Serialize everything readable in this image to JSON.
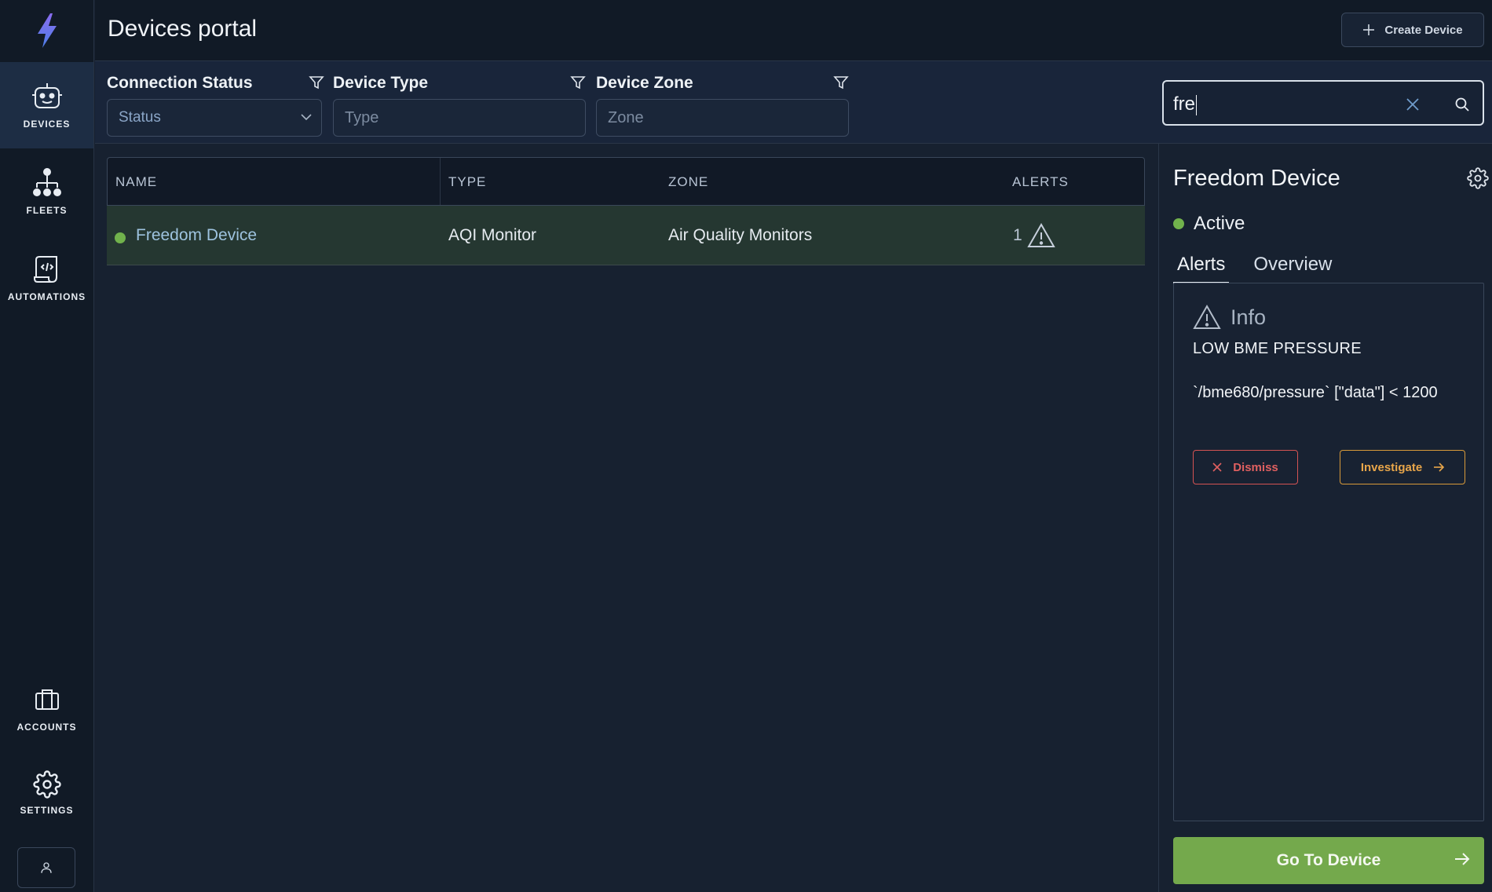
{
  "app": {
    "title": "Devices portal"
  },
  "sidebar": {
    "items": [
      {
        "label": "DEVICES",
        "icon": "robot-icon",
        "active": true
      },
      {
        "label": "FLEETS",
        "icon": "hierarchy-icon"
      },
      {
        "label": "AUTOMATIONS",
        "icon": "script-icon"
      },
      {
        "label": "ACCOUNTS",
        "icon": "briefcase-icon"
      },
      {
        "label": "SETTINGS",
        "icon": "gear-icon"
      }
    ]
  },
  "header": {
    "create_label": "Create Device"
  },
  "filters": {
    "connection_status": {
      "label": "Connection Status",
      "value": "Status"
    },
    "device_type": {
      "label": "Device Type",
      "placeholder": "Type"
    },
    "device_zone": {
      "label": "Device Zone",
      "placeholder": "Zone"
    }
  },
  "search": {
    "value": "fre"
  },
  "table": {
    "columns": [
      "NAME",
      "TYPE",
      "ZONE",
      "ALERTS"
    ],
    "rows": [
      {
        "name": "Freedom Device",
        "type": "AQI Monitor",
        "zone": "Air Quality Monitors",
        "alerts": "1",
        "status_color": "#71b24c"
      }
    ]
  },
  "panel": {
    "title": "Freedom Device",
    "status": "Active",
    "tabs": [
      "Alerts",
      "Overview"
    ],
    "alert": {
      "severity": "Info",
      "name": "LOW BME PRESSURE",
      "rule": "`/bme680/pressure` [\"data\"] < 1200",
      "dismiss_label": "Dismiss",
      "investigate_label": "Investigate"
    },
    "goto_label": "Go To Device"
  },
  "colors": {
    "accent_green": "#74a94c",
    "status_active": "#71b24c",
    "danger": "#d45353",
    "warning": "#d89a3a"
  }
}
